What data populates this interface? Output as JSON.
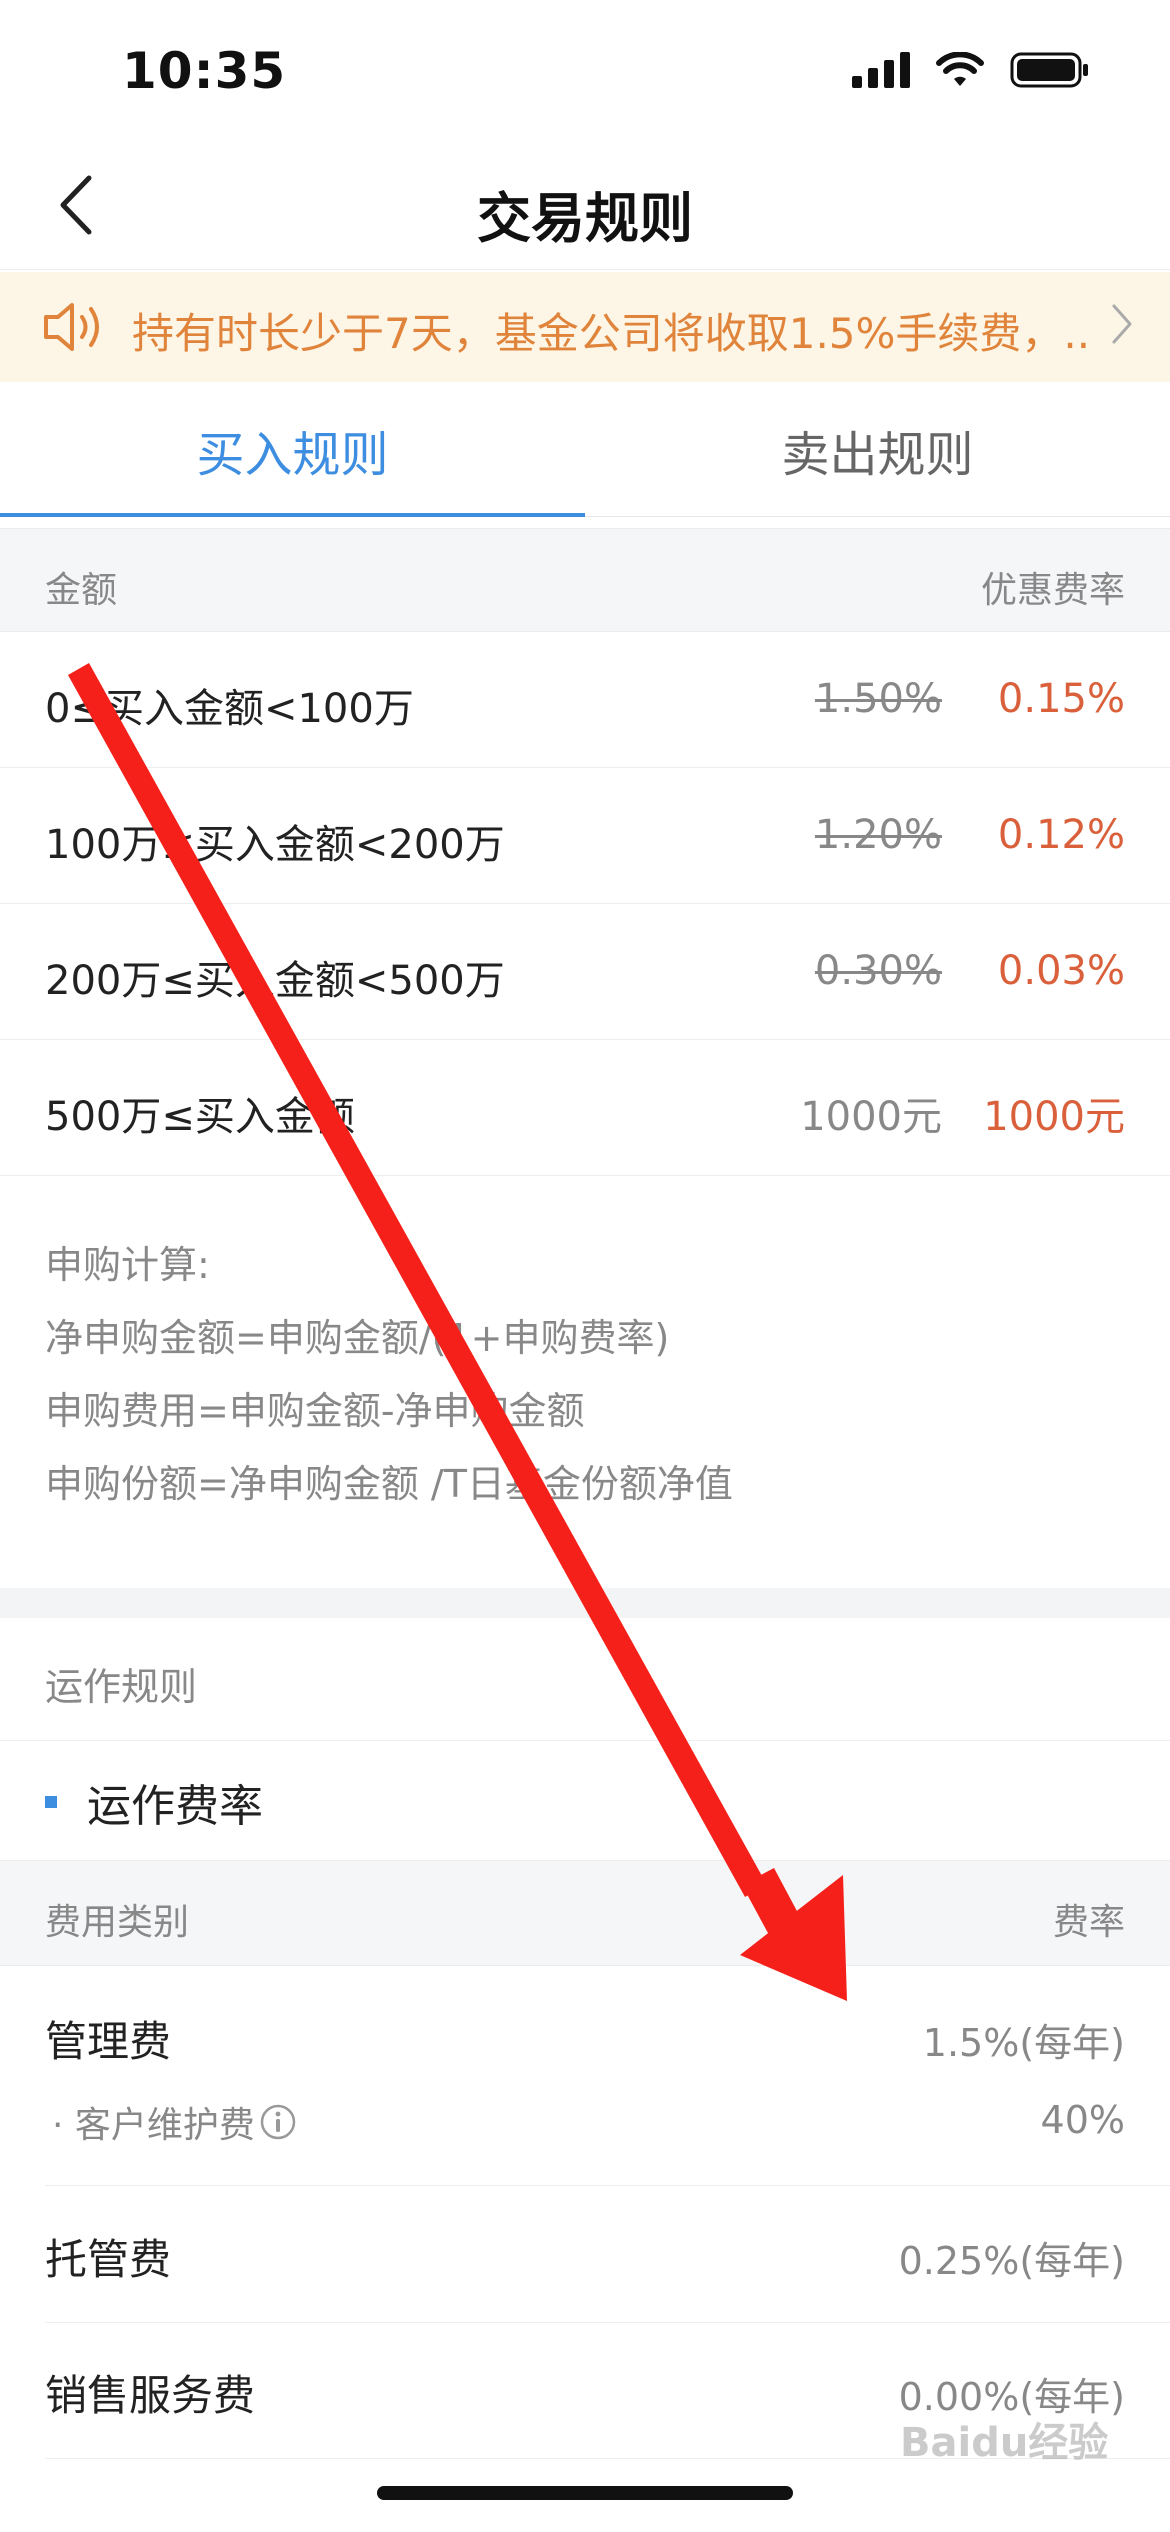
{
  "status": {
    "time": "10:35"
  },
  "nav": {
    "title": "交易规则"
  },
  "notice": {
    "text": "持有时长少于7天，基金公司将收取1.5%手续费，..."
  },
  "tabs": [
    {
      "label": "买入规则",
      "active": true
    },
    {
      "label": "卖出规则",
      "active": false
    }
  ],
  "buy_table": {
    "header_left": "金额",
    "header_right": "优惠费率",
    "rows": [
      {
        "amount": "0≤买入金额<100万",
        "original": "1.50%",
        "discount": "0.15%"
      },
      {
        "amount": "100万≤买入金额<200万",
        "original": "1.20%",
        "discount": "0.12%"
      },
      {
        "amount": "200万≤买入金额<500万",
        "original": "0.30%",
        "discount": "0.03%"
      },
      {
        "amount": "500万≤买入金额",
        "original": "1000元",
        "discount": "1000元"
      }
    ]
  },
  "calc": {
    "lines": [
      "申购计算:",
      "净申购金额=申购金额/(1+申购费率)",
      "申购费用=申购金额-净申购金额",
      "申购份额=净申购金额 /T日基金份额净值"
    ]
  },
  "operations": {
    "section_title": "运作规则",
    "subsection_title": "运作费率",
    "header_left": "费用类别",
    "header_right": "费率",
    "rows": [
      {
        "name": "管理费",
        "value": "1.5%(每年)"
      },
      {
        "name": "· 客户维护费",
        "value": "40%"
      },
      {
        "name": "托管费",
        "value": "0.25%(每年)"
      },
      {
        "name": "销售服务费",
        "value": "0.00%(每年)"
      }
    ]
  },
  "watermark": "Baidu经验",
  "colors": {
    "accent": "#3d8ee0",
    "discount": "#d9603b",
    "notice_text": "#e0843c",
    "notice_bg": "#fdf6e6",
    "annotation_arrow": "#f5201a"
  },
  "icons": [
    "back-chevron-icon",
    "speaker-icon",
    "chevron-right-icon",
    "info-icon",
    "signal-icon",
    "wifi-icon",
    "battery-icon"
  ]
}
